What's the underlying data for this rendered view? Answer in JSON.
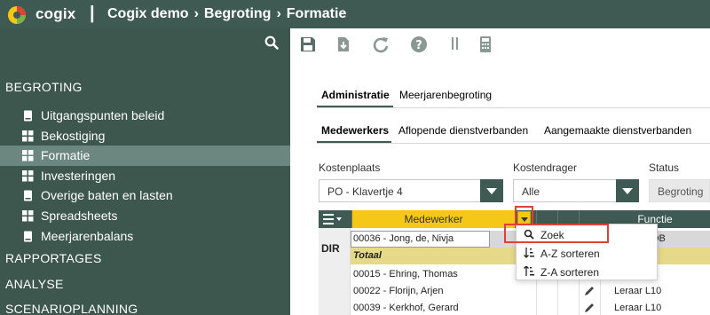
{
  "app": {
    "name": "cogix",
    "breadcrumb": [
      "Cogix demo",
      "Begroting",
      "Formatie"
    ],
    "accent": "#3f5a52",
    "highlight": "#f5c817"
  },
  "sidebar": {
    "sections": {
      "begroting": "BEGROTING",
      "rapportages": "RAPPORTAGES",
      "analyse": "ANALYSE",
      "scenarioplanning": "SCENARIOPLANNING"
    },
    "items": [
      {
        "label": "Uitgangspunten beleid",
        "icon": "book-icon"
      },
      {
        "label": "Bekostiging",
        "icon": "grid-icon"
      },
      {
        "label": "Formatie",
        "icon": "grid-icon",
        "active": true
      },
      {
        "label": "Investeringen",
        "icon": "grid-icon"
      },
      {
        "label": "Overige baten en lasten",
        "icon": "book-icon"
      },
      {
        "label": "Spreadsheets",
        "icon": "grid-icon"
      },
      {
        "label": "Meerjarenbalans",
        "icon": "book-icon"
      }
    ]
  },
  "toolbar": {
    "buttons": [
      "save-icon",
      "download-icon",
      "refresh-icon",
      "help-icon",
      "split-icon",
      "calculator-icon"
    ]
  },
  "tabs": {
    "primary": [
      "Administratie",
      "Meerjarenbegroting"
    ],
    "secondary": [
      "Medewerkers",
      "Aflopende dienstverbanden",
      "Aangemaakte dienstverbanden"
    ]
  },
  "filters": {
    "kostenplaats": {
      "label": "Kostenplaats",
      "value": "PO - Klavertje 4"
    },
    "kostendrager": {
      "label": "Kostendrager",
      "value": "Alle"
    },
    "status": {
      "label": "Status",
      "value": "Begroting"
    }
  },
  "grid": {
    "columns": {
      "medewerker": "Medewerker",
      "functie": "Functie"
    },
    "group": "DIR",
    "first_row": {
      "name": "00036 - Jong, de, Nivja",
      "functie": "OB"
    },
    "total_label": "Totaal",
    "rows": [
      {
        "name": "00015 - Ehring, Thomas",
        "functie": ""
      },
      {
        "name": "00022 - Florijn, Arjen",
        "functie": "Leraar L10"
      },
      {
        "name": "00039 - Kerkhof, Gerard",
        "functie": "Leraar L10"
      }
    ]
  },
  "menu": {
    "items": [
      {
        "label": "Zoek",
        "icon": "search-icon"
      },
      {
        "label": "A-Z sorteren",
        "icon": "sort-asc-icon"
      },
      {
        "label": "Z-A sorteren",
        "icon": "sort-desc-icon"
      }
    ]
  }
}
